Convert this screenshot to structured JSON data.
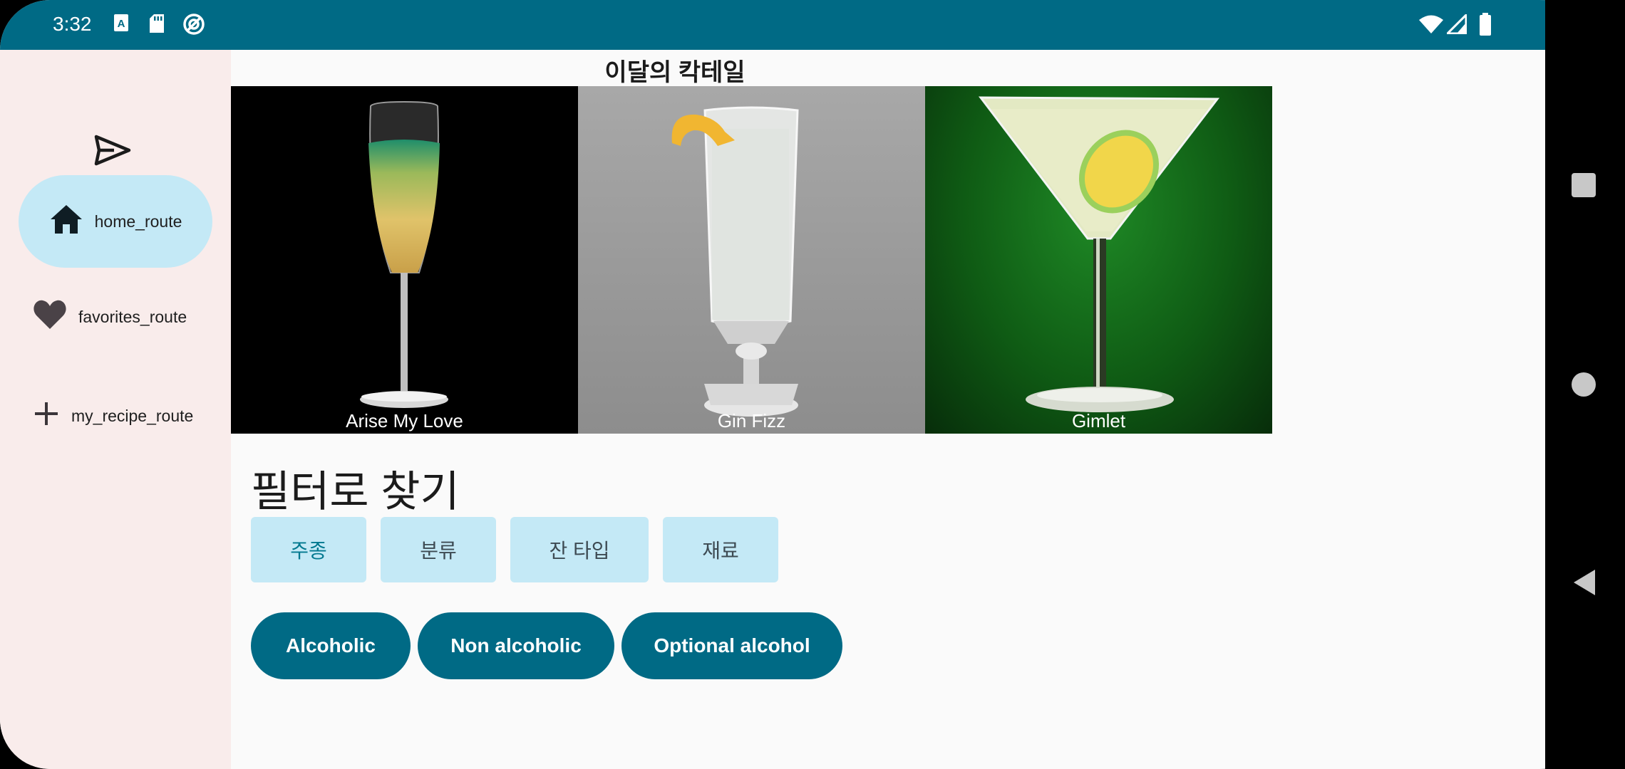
{
  "status_bar": {
    "time": "3:32",
    "left_icons": [
      "keyboard-a-icon",
      "sd-card-icon",
      "circle-slash-icon"
    ],
    "right_icons": [
      "wifi-icon",
      "signal-icon",
      "battery-icon"
    ]
  },
  "nav_rail": {
    "fab_icon": "send-icon",
    "items": [
      {
        "label": "home_route",
        "icon": "home-icon",
        "active": true
      },
      {
        "label": "favorites_route",
        "icon": "heart-icon",
        "active": false
      },
      {
        "label": "my_recipe_route",
        "icon": "plus-icon",
        "active": false
      }
    ]
  },
  "main": {
    "month_title": "이달의 칵테일",
    "cocktails": [
      {
        "name": "Arise My Love"
      },
      {
        "name": "Gin Fizz"
      },
      {
        "name": "Gimlet"
      }
    ],
    "filter_title": "필터로 찾기",
    "filter_tabs": [
      {
        "label": "주종",
        "selected": true
      },
      {
        "label": "분류",
        "selected": false
      },
      {
        "label": "잔 타입",
        "selected": false
      },
      {
        "label": "재료",
        "selected": false
      }
    ],
    "chips": [
      "Alcoholic",
      "Non alcoholic",
      "Optional alcohol"
    ]
  },
  "colors": {
    "primary": "#006a85",
    "rail_bg": "#f9eceb",
    "active_indicator": "#c4e9f6",
    "background": "#fafafa"
  }
}
